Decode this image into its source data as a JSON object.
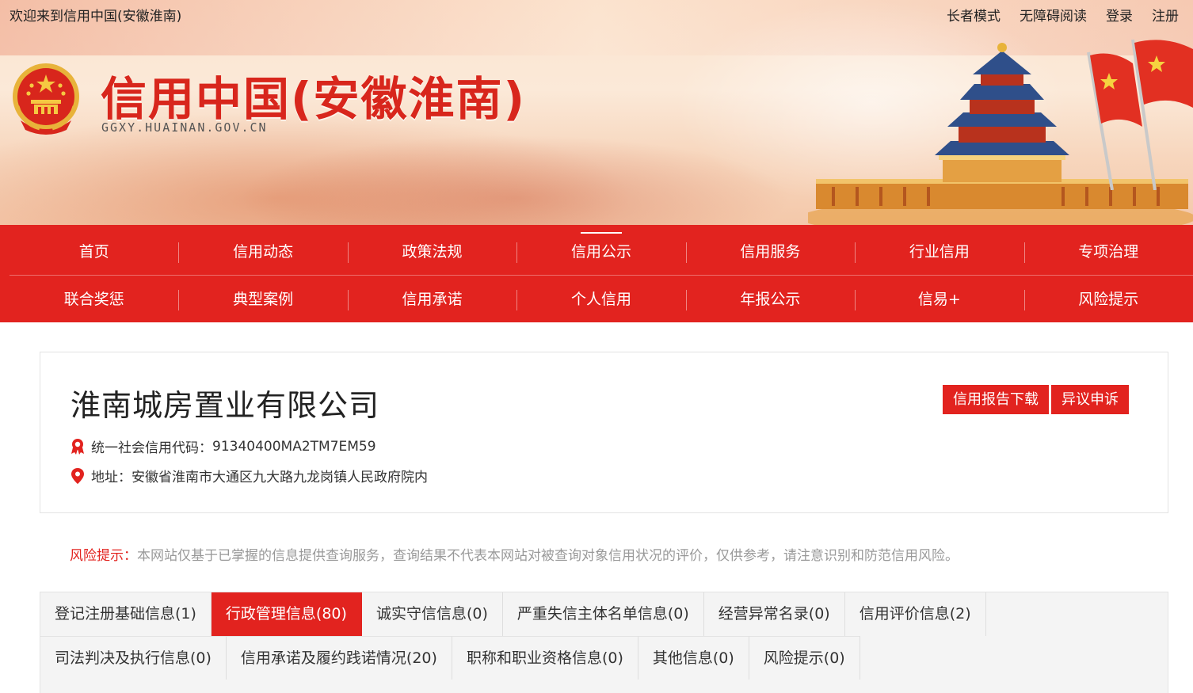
{
  "header": {
    "welcome": "欢迎来到信用中国(安徽淮南)",
    "top_links": [
      "长者模式",
      "无障碍阅读",
      "登录",
      "注册"
    ],
    "site_title": "信用中国(安徽淮南)",
    "site_domain": "GGXY.HUAINAN.GOV.CN"
  },
  "nav": {
    "row1": [
      "首页",
      "信用动态",
      "政策法规",
      "信用公示",
      "信用服务",
      "行业信用",
      "专项治理"
    ],
    "row2": [
      "联合奖惩",
      "典型案例",
      "信用承诺",
      "个人信用",
      "年报公示",
      "信易+",
      "风险提示"
    ],
    "active": "信用公示"
  },
  "company": {
    "name": "淮南城房置业有限公司",
    "credit_code_label": "统一社会信用代码：",
    "credit_code": "91340400MA2TM7EM59",
    "address_label": "地址：",
    "address": "安徽省淮南市大通区九大路九龙岗镇人民政府院内",
    "buttons": {
      "report": "信用报告下载",
      "appeal": "异议申诉"
    }
  },
  "risk_notice": {
    "label": "风险提示：",
    "text": "本网站仅基于已掌握的信息提供查询服务，查询结果不代表本网站对被查询对象信用状况的评价，仅供参考，请注意识别和防范信用风险。"
  },
  "tabs": {
    "row1": [
      "登记注册基础信息(1)",
      "行政管理信息(80)",
      "诚实守信信息(0)",
      "严重失信主体名单信息(0)",
      "经营异常名录(0)",
      "信用评价信息(2)"
    ],
    "row2": [
      "司法判决及执行信息(0)",
      "信用承诺及履约践诺情况(20)",
      "职称和职业资格信息(0)",
      "其他信息(0)",
      "风险提示(0)"
    ],
    "active": "行政管理信息(80)"
  },
  "colors": {
    "brand_red": "#e2231f",
    "title_red": "#d8261c"
  }
}
